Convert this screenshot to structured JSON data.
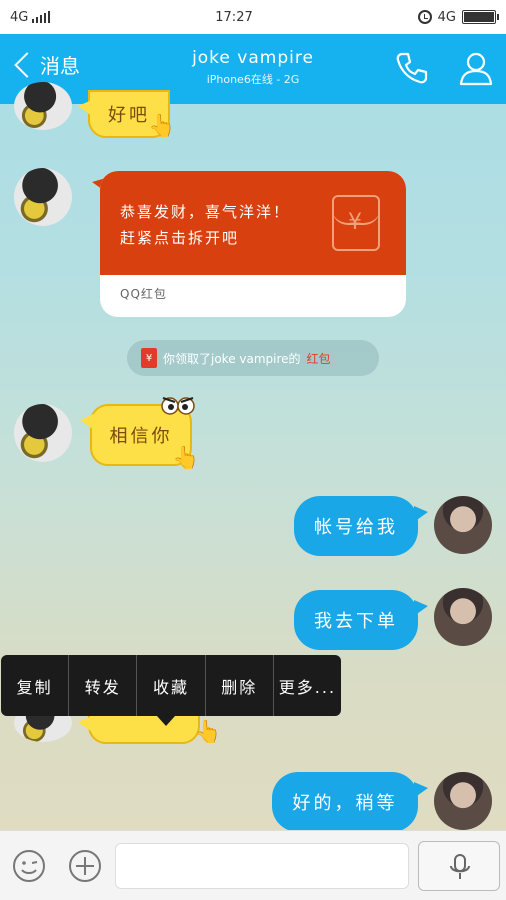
{
  "status_bar": {
    "network_left": "4G",
    "time": "17:27",
    "network_right": "4G"
  },
  "header": {
    "back_label": "消息",
    "title": "joke vampire",
    "subtitle": "iPhone6在线 - 2G",
    "background": "#16b2ef"
  },
  "messages": {
    "partial_top_text": "好吧",
    "red_packet": {
      "line1": "恭喜发财，喜气洋洋！",
      "line2": "赶紧点击拆开吧",
      "footer": "QQ红包",
      "color": "#d8400f"
    },
    "notice": {
      "prefix": "你领取了joke vampire的",
      "highlight": "红包",
      "icon_label": "¥"
    },
    "believe_you": "相信你",
    "account_to_me": "帐号给我",
    "going_to_order": "我去下单",
    "ok_wait": "好的，稍等"
  },
  "context_menu": {
    "items": [
      "复制",
      "转发",
      "收藏",
      "删除",
      "更多..."
    ]
  },
  "input_bar": {
    "text_value": ""
  },
  "icons": {
    "back": "chevron-left-icon",
    "phone": "phone-icon",
    "profile": "person-icon",
    "emoji": "emoji-icon",
    "plus": "plus-icon",
    "mic": "microphone-icon"
  }
}
